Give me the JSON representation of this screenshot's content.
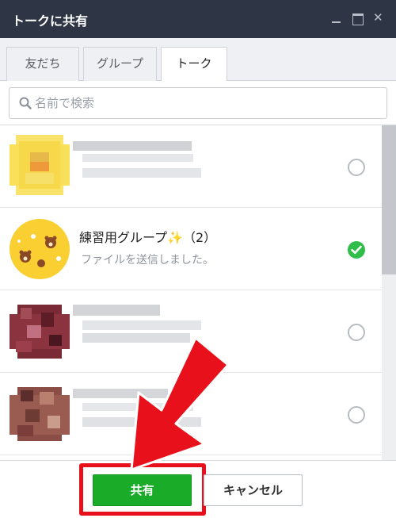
{
  "window": {
    "title": "トークに共有",
    "minimize_icon": "minimize-icon",
    "maximize_icon": "maximize-icon",
    "close_icon": "close-icon",
    "close_glyph": "✕"
  },
  "tabs": [
    {
      "label": "友だち",
      "active": false
    },
    {
      "label": "グループ",
      "active": false
    },
    {
      "label": "トーク",
      "active": true
    }
  ],
  "search": {
    "placeholder": "名前で検索",
    "value": "",
    "icon": "search-icon"
  },
  "chats": [
    {
      "name": "",
      "subtitle": "",
      "selected": false,
      "pixelated": true
    },
    {
      "name": "練習用グループ✨（2）",
      "subtitle": "ファイルを送信しました。",
      "selected": true,
      "pixelated": false
    },
    {
      "name": "",
      "subtitle": "",
      "selected": false,
      "pixelated": true
    },
    {
      "name": "",
      "subtitle": "",
      "selected": false,
      "pixelated": true
    }
  ],
  "footer": {
    "share_label": "共有",
    "cancel_label": "キャンセル"
  },
  "colors": {
    "titlebar": "#2e3645",
    "primary_green": "#1aab28",
    "check_green": "#2fbe49",
    "annotation_red": "#e8101a"
  }
}
